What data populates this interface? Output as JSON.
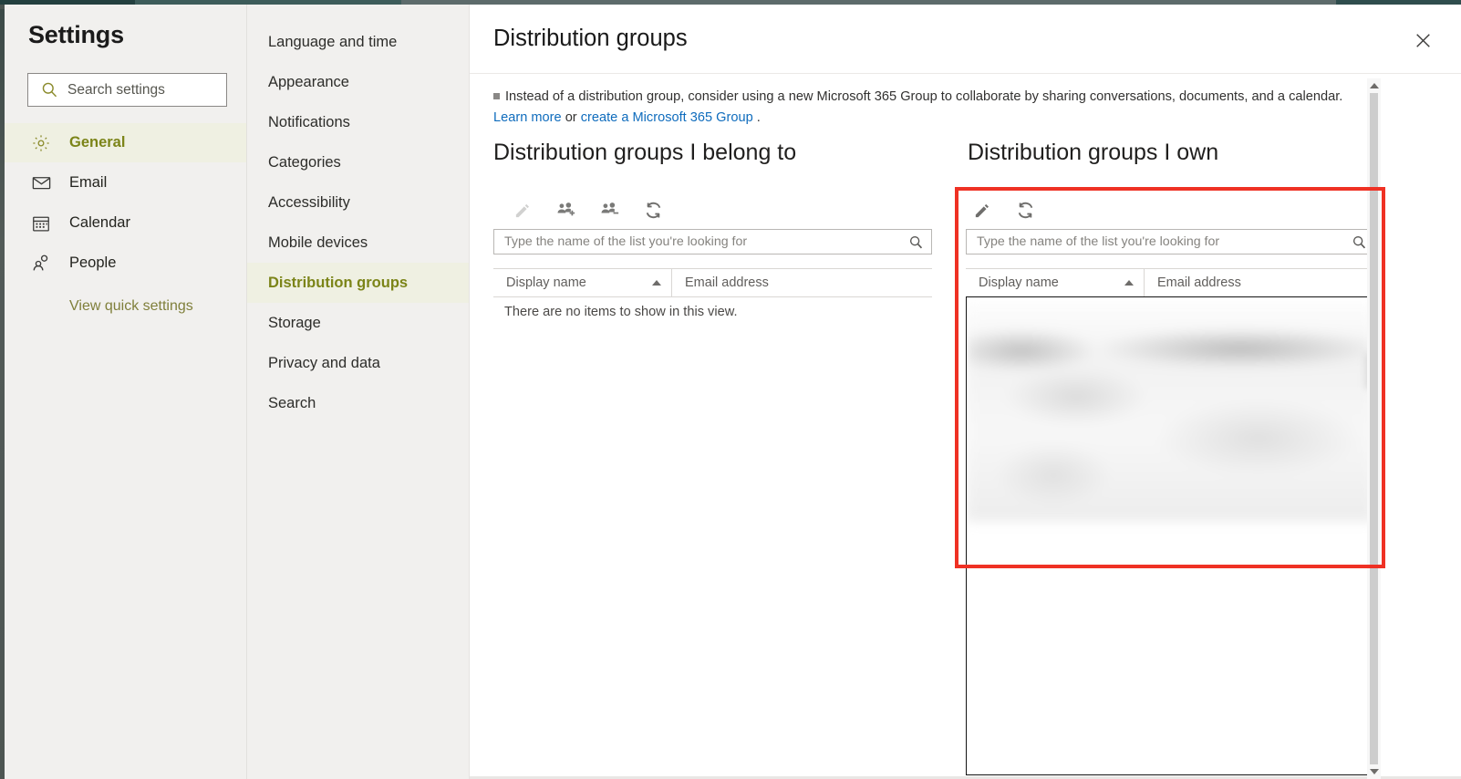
{
  "app": {
    "accent_olive": "#7b8418",
    "accent_olive_bg": "#eff0e2",
    "link_blue": "#0f6cbd",
    "annotation_red": "#ef3124"
  },
  "sidebar": {
    "title": "Settings",
    "search": {
      "placeholder": "Search settings",
      "icon": "search-icon"
    },
    "items": [
      {
        "label": "General",
        "icon": "gear-icon",
        "selected": true
      },
      {
        "label": "Email",
        "icon": "envelope-icon",
        "selected": false
      },
      {
        "label": "Calendar",
        "icon": "calendar-icon",
        "selected": false
      },
      {
        "label": "People",
        "icon": "people-icon",
        "selected": false
      }
    ],
    "quick_settings_link": "View quick settings"
  },
  "subnav": {
    "items": [
      {
        "label": "Language and time",
        "selected": false
      },
      {
        "label": "Appearance",
        "selected": false
      },
      {
        "label": "Notifications",
        "selected": false
      },
      {
        "label": "Categories",
        "selected": false
      },
      {
        "label": "Accessibility",
        "selected": false
      },
      {
        "label": "Mobile devices",
        "selected": false
      },
      {
        "label": "Distribution groups",
        "selected": true
      },
      {
        "label": "Storage",
        "selected": false
      },
      {
        "label": "Privacy and data",
        "selected": false
      },
      {
        "label": "Search",
        "selected": false
      }
    ]
  },
  "main": {
    "title": "Distribution groups",
    "close_label": "✕",
    "info": {
      "text": "Instead of a distribution group, consider using a new Microsoft 365 Group to collaborate by sharing conversations, documents, and a calendar.",
      "link_learn_more": "Learn more",
      "between": " or ",
      "link_create": "create a Microsoft 365 Group",
      "trailing": " ."
    },
    "belong_panel": {
      "heading": "Distribution groups I belong to",
      "toolbar": [
        {
          "name": "edit-button",
          "icon": "pencil-icon",
          "disabled": true
        },
        {
          "name": "join-group-button",
          "icon": "people-add-icon",
          "disabled": false
        },
        {
          "name": "leave-group-button",
          "icon": "people-remove-icon",
          "disabled": false
        },
        {
          "name": "refresh-button",
          "icon": "refresh-icon",
          "disabled": false
        }
      ],
      "search_placeholder": "Type the name of the list you're looking for",
      "columns": [
        {
          "label": "Display name",
          "sorted": true
        },
        {
          "label": "Email address",
          "sorted": false
        }
      ],
      "empty_message": "There are no items to show in this view.",
      "rows": []
    },
    "own_panel": {
      "heading": "Distribution groups I own",
      "toolbar": [
        {
          "name": "edit-button",
          "icon": "pencil-icon",
          "disabled": false
        },
        {
          "name": "refresh-button",
          "icon": "refresh-icon",
          "disabled": false
        }
      ],
      "search_placeholder": "Type the name of the list you're looking for",
      "columns": [
        {
          "label": "Display name",
          "sorted": true
        },
        {
          "label": "Email address",
          "sorted": false
        }
      ],
      "rows_redacted": true
    }
  },
  "scrollbar": {
    "up_icon": "caret-up-icon",
    "down_icon": "caret-down-icon"
  }
}
